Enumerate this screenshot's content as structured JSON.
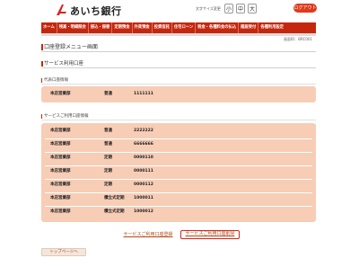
{
  "header": {
    "bank_name": "あいち銀行",
    "fontsize_label": "文字サイズ変更",
    "font_sizes": [
      "小",
      "中",
      "大"
    ],
    "logout_label": "ログアウト"
  },
  "nav": {
    "items": [
      "ホーム",
      "残高・明細照会",
      "振込・振替",
      "定期預金",
      "外貨預金",
      "投資信託",
      "住宅ローン",
      "税金・各種料金の払込",
      "諸届受付",
      "各種利用設定"
    ]
  },
  "screen_id": "画面ID：BRC001",
  "page_title": "口座登録メニュー画面",
  "service_section_title": "サービス利用口座",
  "representative": {
    "label": "代表口座情報",
    "row": {
      "branch": "本店営業部",
      "type": "普通",
      "number": "1111111"
    }
  },
  "service_accounts": {
    "label": "サービスご利用口座情報",
    "rows": [
      {
        "branch": "本店営業部",
        "type": "普通",
        "number": "2222222"
      },
      {
        "branch": "本店営業部",
        "type": "普通",
        "number": "6666666"
      },
      {
        "branch": "本店営業部",
        "type": "定期",
        "number": "0000110"
      },
      {
        "branch": "本店営業部",
        "type": "定期",
        "number": "0000111"
      },
      {
        "branch": "本店営業部",
        "type": "定期",
        "number": "0000112"
      },
      {
        "branch": "本店営業部",
        "type": "積立式定期",
        "number": "1000011"
      },
      {
        "branch": "本店営業部",
        "type": "積立式定期",
        "number": "1000012"
      }
    ]
  },
  "links": {
    "register": "サービスご利用口座登録",
    "delete": "サービスご利用口座削除"
  },
  "top_button": "トップページへ",
  "colors": {
    "brand": "#c4270d",
    "panel": "#f7cdb6",
    "logout": "#e0391c"
  }
}
